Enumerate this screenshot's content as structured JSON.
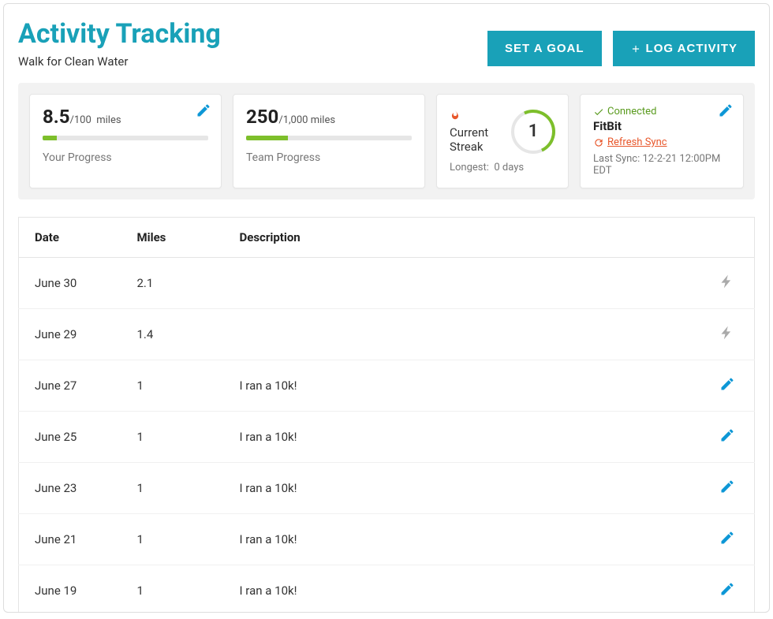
{
  "header": {
    "title": "Activity Tracking",
    "subtitle": "Walk for Clean Water",
    "set_goal_label": "SET A GOAL",
    "log_activity_label": "LOG ACTIVITY"
  },
  "cards": {
    "your_progress": {
      "value": "8.5",
      "total": "100",
      "unit": "miles",
      "label": "Your Progress",
      "percent": 8.5
    },
    "team_progress": {
      "value": "250",
      "total": "1,000",
      "unit": "miles",
      "label": "Team Progress",
      "percent": 25
    },
    "streak": {
      "title": "Current Streak",
      "value": "1",
      "longest_label": "Longest:",
      "longest_value": "0 days"
    },
    "sync": {
      "connected_label": "Connected",
      "device": "FitBit",
      "refresh_label": "Refresh Sync",
      "last_sync": "Last Sync: 12-2-21 12:00PM EDT"
    }
  },
  "table": {
    "headers": {
      "date": "Date",
      "miles": "Miles",
      "description": "Description"
    },
    "rows": [
      {
        "date": "June 30",
        "miles": "2.1",
        "description": "",
        "icon": "bolt"
      },
      {
        "date": "June 29",
        "miles": "1.4",
        "description": "",
        "icon": "bolt"
      },
      {
        "date": "June 27",
        "miles": "1",
        "description": "I ran a 10k!",
        "icon": "pencil"
      },
      {
        "date": "June 25",
        "miles": "1",
        "description": "I ran a 10k!",
        "icon": "pencil"
      },
      {
        "date": "June 23",
        "miles": "1",
        "description": "I ran a 10k!",
        "icon": "pencil"
      },
      {
        "date": "June 21",
        "miles": "1",
        "description": "I ran a 10k!",
        "icon": "pencil"
      },
      {
        "date": "June 19",
        "miles": "1",
        "description": "I ran a 10k!",
        "icon": "pencil"
      }
    ]
  }
}
